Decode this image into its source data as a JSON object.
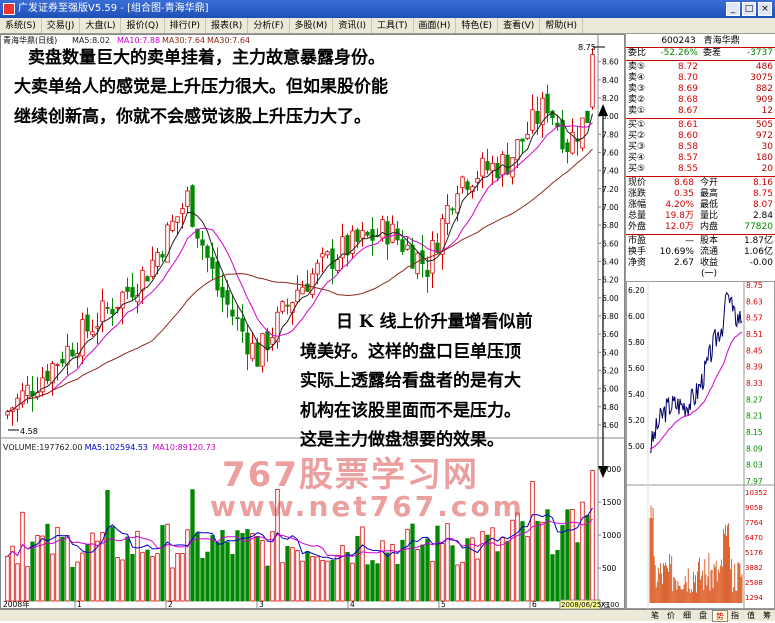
{
  "window": {
    "title": "广发证券至强版V5.59 - [组合图-青海华鼎]",
    "min_label": "_",
    "max_label": "□",
    "close_label": "×"
  },
  "menu": [
    "系统(S)",
    "交易(J)",
    "大盘(L)",
    "报价(Q)",
    "排行(P)",
    "报表(R)",
    "分析(F)",
    "多股(M)",
    "资讯(I)",
    "工具(T)",
    "画面(H)",
    "特色(E)",
    "查看(V)",
    "帮助(H)"
  ],
  "chart": {
    "stock_title": "青海华鼎(日线)",
    "ma_legend": [
      {
        "label": "MA5:8.02",
        "color": "#222222"
      },
      {
        "label": "MA10:7.88",
        "color": "#d000d0"
      },
      {
        "label": "MA30:7.64",
        "color": "#8b2a1a"
      },
      {
        "label": "MA30:7.64",
        "color": "#8b2a1a"
      }
    ],
    "price_ticks": [
      "8.60",
      "8.40",
      "8.20",
      "8.00",
      "7.80",
      "7.60",
      "7.40",
      "7.20",
      "7.00",
      "6.80",
      "6.60",
      "6.40",
      "6.20",
      "6.00",
      "5.80",
      "5.60",
      "5.40",
      "5.20",
      "5.00",
      "4.80",
      "4.60"
    ],
    "high_marker": "8.75",
    "low_marker": "4.58",
    "volume_legend": [
      {
        "label": "VOLUME:197762.00",
        "color": "#222222"
      },
      {
        "label": "MA5:102594.53",
        "color": "#0000cc"
      },
      {
        "label": "MA10:89120.73",
        "color": "#d000d0"
      }
    ],
    "volume_ticks": [
      "2000",
      "1500",
      "1000",
      "500"
    ],
    "volume_unit": "X100",
    "date_start": "2008年",
    "month_labels": [
      "1",
      "2",
      "3",
      "4",
      "5",
      "6"
    ],
    "date_end": "2008/06/25/三",
    "colors": {
      "up": "#d40000",
      "down": "#008800",
      "ma5": "#222222",
      "ma10": "#d000d0",
      "ma30": "#8b2a1a"
    }
  },
  "annotations": {
    "top_line1": "卖盘数量巨大的卖单挂着，主力故意暴露身份。",
    "top_line2": "大卖单给人的感觉是上升压力很大。但如果股价能",
    "top_line3": "继续创新高，你就不会感觉该股上升压力大了。",
    "mid_line1": "日 K 线上价升量增看似前",
    "mid_line2": "境美好。这样的盘口巨单压顶",
    "mid_line3": "实际上透露给看盘者的是有大",
    "mid_line4": "机构在该股里面而不是压力。",
    "mid_line5": "这是主力做盘想要的效果。"
  },
  "watermark": {
    "line1": "767股票学习网",
    "line2": "www.net767.com"
  },
  "quote": {
    "code": "600243",
    "name": "青海华鼎",
    "weibi_label": "委比",
    "weibi_value": "-52.26%",
    "weicha_label": "委差",
    "weicha_value": "-3737",
    "sells": [
      {
        "label": "卖⑤",
        "price": "8.72",
        "vol": "486"
      },
      {
        "label": "卖④",
        "price": "8.70",
        "vol": "3075"
      },
      {
        "label": "卖③",
        "price": "8.69",
        "vol": "882"
      },
      {
        "label": "卖②",
        "price": "8.68",
        "vol": "909"
      },
      {
        "label": "卖①",
        "price": "8.67",
        "vol": "12"
      }
    ],
    "buys": [
      {
        "label": "买①",
        "price": "8.61",
        "vol": "505"
      },
      {
        "label": "买②",
        "price": "8.60",
        "vol": "972"
      },
      {
        "label": "买③",
        "price": "8.58",
        "vol": "30"
      },
      {
        "label": "买④",
        "price": "8.57",
        "vol": "180"
      },
      {
        "label": "买⑤",
        "price": "8.55",
        "vol": "20"
      }
    ],
    "stats": [
      {
        "a": "现价",
        "b": "8.68",
        "c": "今开",
        "d": "8.16",
        "bc": "red",
        "dc": "red"
      },
      {
        "a": "涨跌",
        "b": "0.35",
        "c": "最高",
        "d": "8.75",
        "bc": "red",
        "dc": "red"
      },
      {
        "a": "涨幅",
        "b": "4.20%",
        "c": "最低",
        "d": "8.07",
        "bc": "red",
        "dc": "red"
      },
      {
        "a": "总量",
        "b": "19.8万",
        "c": "量比",
        "d": "2.84",
        "bc": "red",
        "dc": "blk"
      },
      {
        "a": "外盘",
        "b": "12.0万",
        "c": "内盘",
        "d": "77820",
        "bc": "red",
        "dc": "green"
      }
    ],
    "info": [
      {
        "a": "市盈",
        "b": "—",
        "c": "股本",
        "d": "1.87亿"
      },
      {
        "a": "换手",
        "b": "10.69%",
        "c": "流通",
        "d": "1.06亿"
      },
      {
        "a": "净资",
        "b": "2.67",
        "c": "收益(一)",
        "d": "-0.00"
      }
    ],
    "intraday_ticks": [
      "8.75",
      "8.63",
      "8.57",
      "8.51",
      "8.45",
      "8.39",
      "8.33",
      "8.27",
      "8.21",
      "8.15",
      "8.09",
      "8.03",
      "7.97"
    ],
    "intraday_left_ticks": [
      "6.20",
      "6.00",
      "5.80",
      "5.60",
      "5.40",
      "5.20",
      "5.00"
    ],
    "intraday_vol_ticks": [
      "10352",
      "9058",
      "7764",
      "6470",
      "5176",
      "3882",
      "2588",
      "1294"
    ]
  },
  "bottom_tabs": [
    "笔",
    "价",
    "细",
    "盘",
    "势",
    "指",
    "值",
    "筹"
  ]
}
